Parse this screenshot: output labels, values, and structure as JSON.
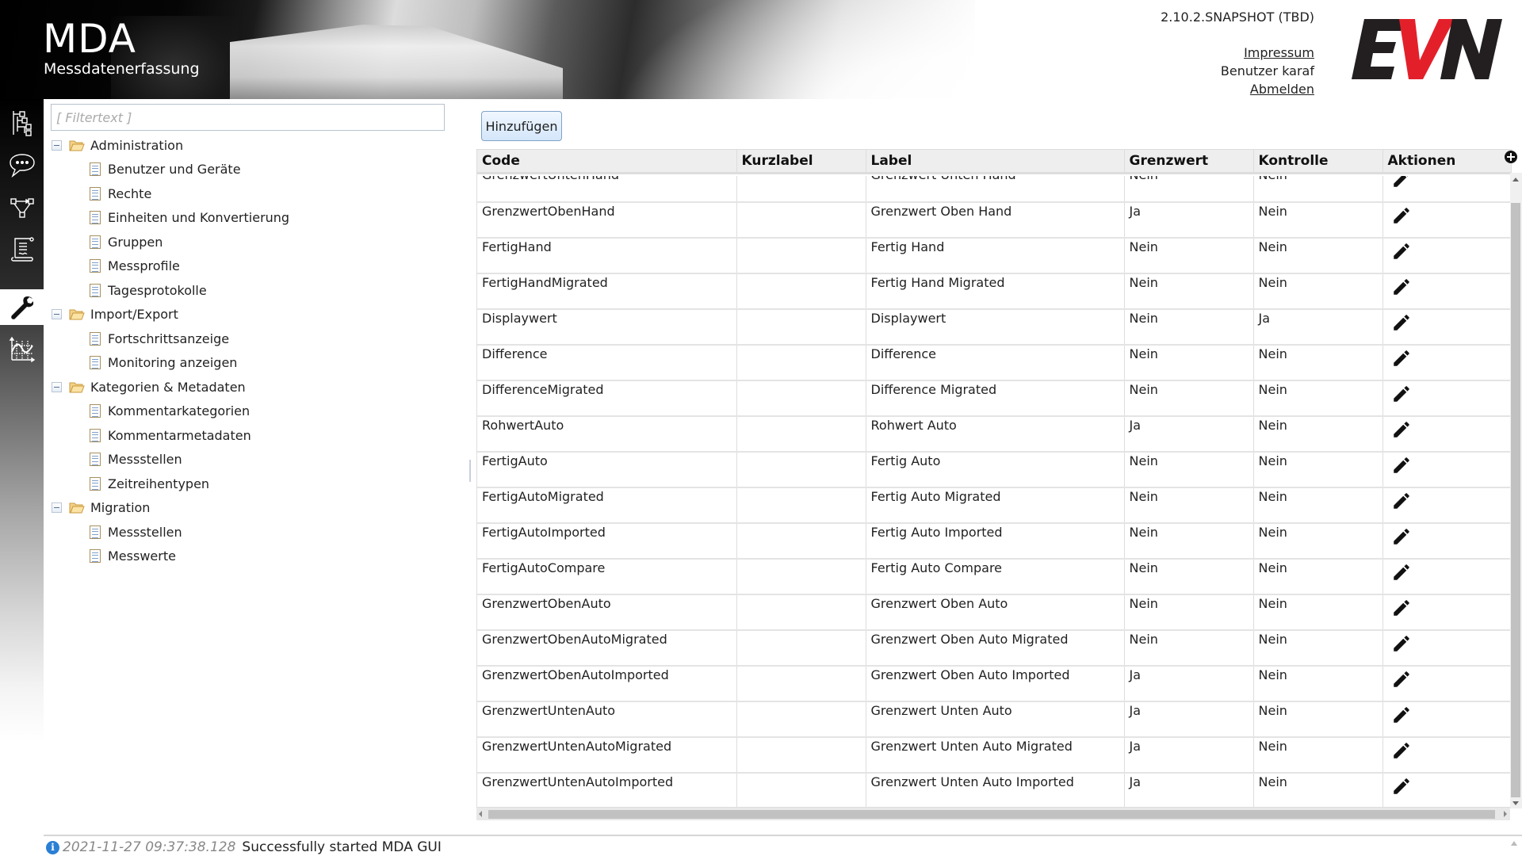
{
  "header": {
    "app_title": "MDA",
    "app_subtitle": "Messdatenerfassung",
    "version": "2.10.2.SNAPSHOT (TBD)",
    "impressum_link": "Impressum",
    "user_text": "Benutzer karaf",
    "logout_link": "Abmelden",
    "brand_logo": {
      "text_e": "E",
      "text_v": "V",
      "text_n": "N",
      "color_dark": "#231f20",
      "color_accent": "#e3202a"
    }
  },
  "iconbar": {
    "items": [
      {
        "name": "hierarchy-icon",
        "active": false
      },
      {
        "name": "comment-icon",
        "active": false
      },
      {
        "name": "workflow-icon",
        "active": false
      },
      {
        "name": "script-icon",
        "active": false
      },
      {
        "name": "wrench-icon",
        "active": true
      },
      {
        "name": "chart-icon",
        "active": false
      }
    ]
  },
  "tree": {
    "filter_placeholder": "[ Filtertext ]",
    "filter_value": "",
    "groups": [
      {
        "label": "Administration",
        "expanded": true,
        "children": [
          "Benutzer und Geräte",
          "Rechte",
          "Einheiten und Konvertierung",
          "Gruppen",
          "Messprofile",
          "Tagesprotokolle"
        ]
      },
      {
        "label": "Import/Export",
        "expanded": true,
        "children": [
          "Fortschrittsanzeige",
          "Monitoring anzeigen"
        ]
      },
      {
        "label": "Kategorien & Metadaten",
        "expanded": true,
        "children": [
          "Kommentarkategorien",
          "Kommentarmetadaten",
          "Messstellen",
          "Zeitreihentypen"
        ]
      },
      {
        "label": "Migration",
        "expanded": true,
        "children": [
          "Messstellen",
          "Messwerte"
        ]
      }
    ]
  },
  "content": {
    "add_button_label": "Hinzufügen",
    "table": {
      "columns": [
        "Code",
        "Kurzlabel",
        "Label",
        "Grenzwert",
        "Kontrolle",
        "Aktionen"
      ],
      "action_icon": "pencil-icon",
      "rows": [
        {
          "code": "GrenzwertUntenHand",
          "kurzlabel": "",
          "label": "Grenzwert Unten Hand",
          "grenzwert": "Nein",
          "kontrolle": "Nein"
        },
        {
          "code": "GrenzwertObenHand",
          "kurzlabel": "",
          "label": "Grenzwert Oben Hand",
          "grenzwert": "Ja",
          "kontrolle": "Nein"
        },
        {
          "code": "FertigHand",
          "kurzlabel": "",
          "label": "Fertig Hand",
          "grenzwert": "Nein",
          "kontrolle": "Nein"
        },
        {
          "code": "FertigHandMigrated",
          "kurzlabel": "",
          "label": "Fertig Hand Migrated",
          "grenzwert": "Nein",
          "kontrolle": "Nein"
        },
        {
          "code": "Displaywert",
          "kurzlabel": "",
          "label": "Displaywert",
          "grenzwert": "Nein",
          "kontrolle": "Ja"
        },
        {
          "code": "Difference",
          "kurzlabel": "",
          "label": "Difference",
          "grenzwert": "Nein",
          "kontrolle": "Nein"
        },
        {
          "code": "DifferenceMigrated",
          "kurzlabel": "",
          "label": "Difference Migrated",
          "grenzwert": "Nein",
          "kontrolle": "Nein"
        },
        {
          "code": "RohwertAuto",
          "kurzlabel": "",
          "label": "Rohwert Auto",
          "grenzwert": "Ja",
          "kontrolle": "Nein"
        },
        {
          "code": "FertigAuto",
          "kurzlabel": "",
          "label": "Fertig Auto",
          "grenzwert": "Nein",
          "kontrolle": "Nein"
        },
        {
          "code": "FertigAutoMigrated",
          "kurzlabel": "",
          "label": "Fertig Auto Migrated",
          "grenzwert": "Nein",
          "kontrolle": "Nein"
        },
        {
          "code": "FertigAutoImported",
          "kurzlabel": "",
          "label": "Fertig Auto Imported",
          "grenzwert": "Nein",
          "kontrolle": "Nein"
        },
        {
          "code": "FertigAutoCompare",
          "kurzlabel": "",
          "label": "Fertig Auto Compare",
          "grenzwert": "Nein",
          "kontrolle": "Nein"
        },
        {
          "code": "GrenzwertObenAuto",
          "kurzlabel": "",
          "label": "Grenzwert Oben Auto",
          "grenzwert": "Nein",
          "kontrolle": "Nein"
        },
        {
          "code": "GrenzwertObenAutoMigrated",
          "kurzlabel": "",
          "label": "Grenzwert Oben Auto Migrated",
          "grenzwert": "Nein",
          "kontrolle": "Nein"
        },
        {
          "code": "GrenzwertObenAutoImported",
          "kurzlabel": "",
          "label": "Grenzwert Oben Auto Imported",
          "grenzwert": "Ja",
          "kontrolle": "Nein"
        },
        {
          "code": "GrenzwertUntenAuto",
          "kurzlabel": "",
          "label": "Grenzwert Unten Auto",
          "grenzwert": "Ja",
          "kontrolle": "Nein"
        },
        {
          "code": "GrenzwertUntenAutoMigrated",
          "kurzlabel": "",
          "label": "Grenzwert Unten Auto Migrated",
          "grenzwert": "Ja",
          "kontrolle": "Nein"
        },
        {
          "code": "GrenzwertUntenAutoImported",
          "kurzlabel": "",
          "label": "Grenzwert Unten Auto Imported",
          "grenzwert": "Ja",
          "kontrolle": "Nein"
        }
      ]
    }
  },
  "status": {
    "icon": "info-icon",
    "timestamp": "2021-11-27 09:37:38.128",
    "message": "Successfully started MDA GUI"
  }
}
